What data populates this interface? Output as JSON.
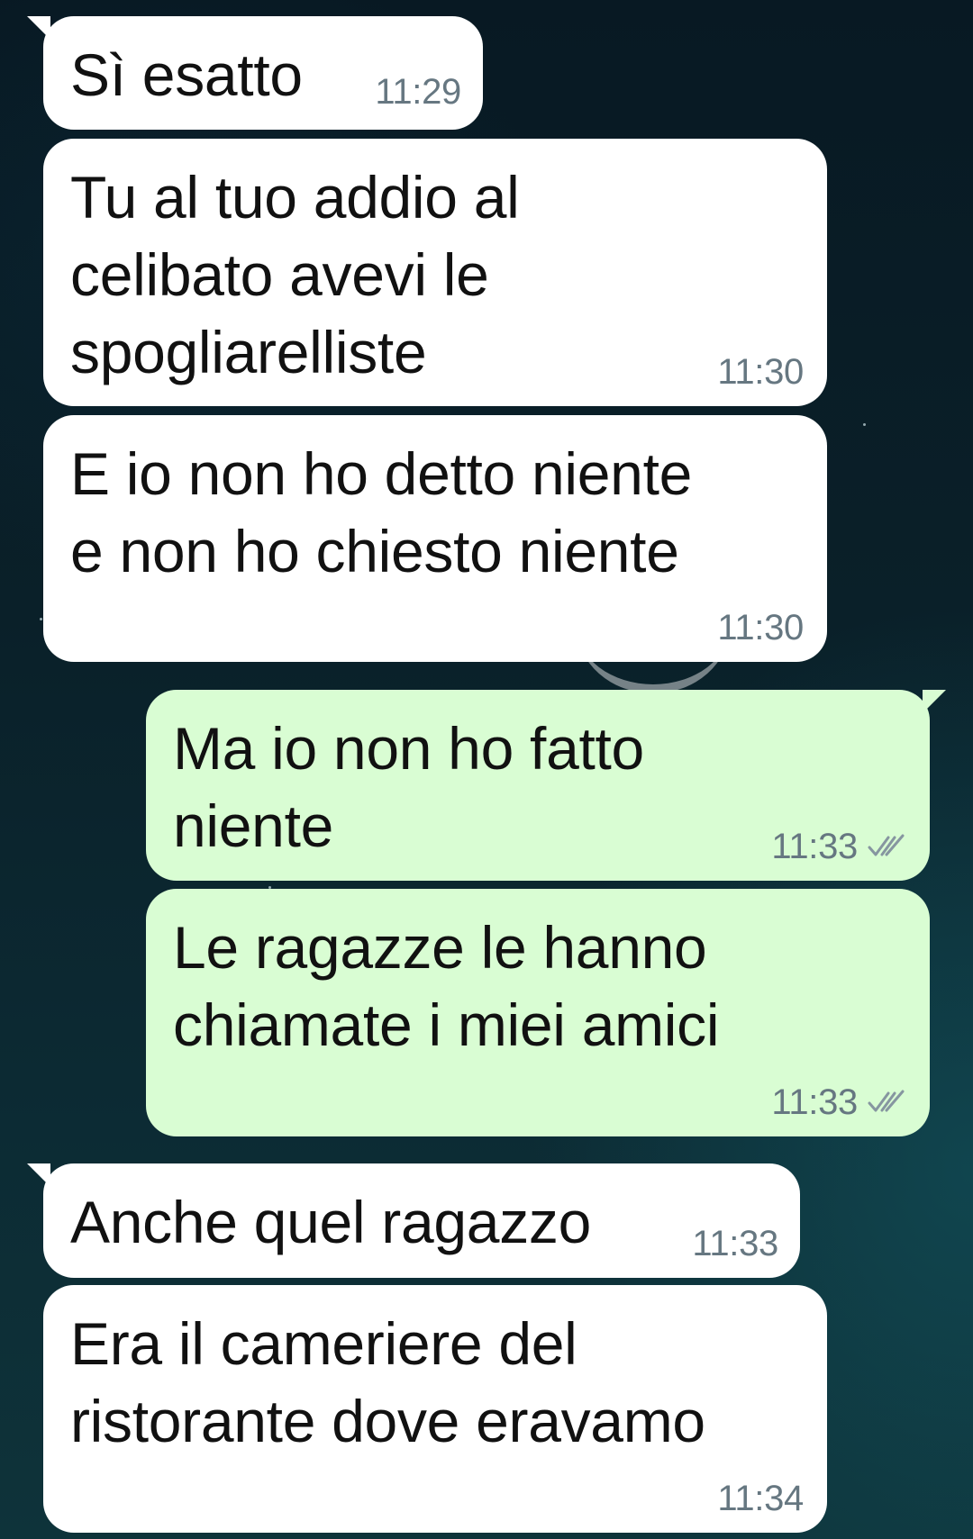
{
  "colors": {
    "incoming_bubble": "#ffffff",
    "outgoing_bubble": "#d9fdd3",
    "timestamp": "#667781",
    "text": "#111111"
  },
  "messages": [
    {
      "direction": "incoming",
      "text": "Sì esatto",
      "time": "11:29"
    },
    {
      "direction": "incoming",
      "text": "Tu al tuo addio al\ncelibato avevi le\nspogliarelliste",
      "time": "11:30"
    },
    {
      "direction": "incoming",
      "text": "E io non ho detto niente\ne non ho chiesto niente",
      "time": "11:30"
    },
    {
      "direction": "outgoing",
      "text": "Ma io non ho fatto\nniente",
      "time": "11:33",
      "status_icon": "double-check-icon"
    },
    {
      "direction": "outgoing",
      "text": "Le ragazze le hanno\nchiamate i miei amici",
      "time": "11:33",
      "status_icon": "double-check-icon"
    },
    {
      "direction": "incoming",
      "text": "Anche quel ragazzo",
      "time": "11:33"
    },
    {
      "direction": "incoming",
      "text": "Era il cameriere del\nristorante dove eravamo",
      "time": "11:34"
    }
  ]
}
